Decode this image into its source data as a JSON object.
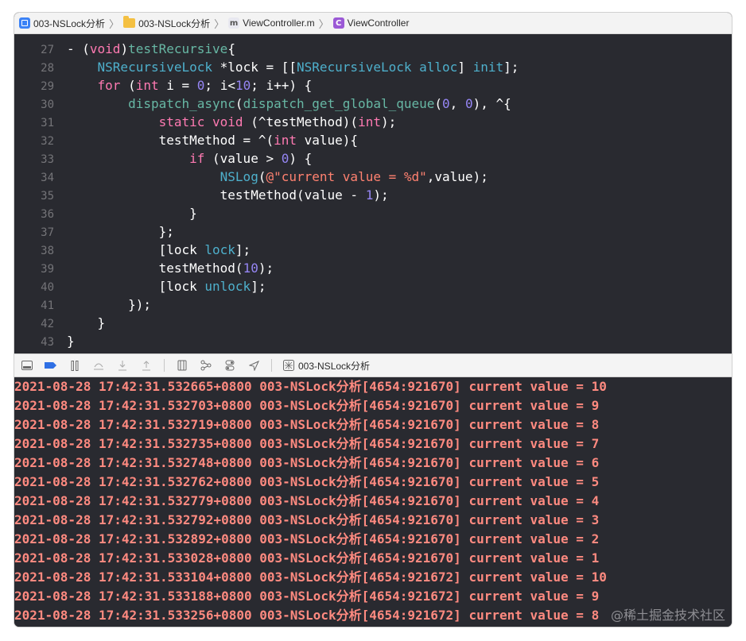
{
  "breadcrumb": {
    "items": [
      {
        "label": "003-NSLock分析",
        "icon": "project-icon"
      },
      {
        "label": "003-NSLock分析",
        "icon": "folder-icon"
      },
      {
        "label": "ViewController.m",
        "icon": "m-file-icon"
      },
      {
        "label": "ViewController",
        "icon": "class-icon"
      }
    ]
  },
  "editor": {
    "lines": [
      {
        "num": "27",
        "tokens": [
          [
            "pl",
            "- ("
          ],
          [
            "kw",
            "void"
          ],
          [
            "pl",
            ")"
          ],
          [
            "fn",
            "testRecursive"
          ],
          [
            "pl",
            "{"
          ]
        ]
      },
      {
        "num": "28",
        "tokens": [
          [
            "pl",
            "    "
          ],
          [
            "ty",
            "NSRecursiveLock"
          ],
          [
            "pl",
            " *lock = [["
          ],
          [
            "ty",
            "NSRecursiveLock"
          ],
          [
            "pl",
            " "
          ],
          [
            "ty",
            "alloc"
          ],
          [
            "pl",
            "] "
          ],
          [
            "ty",
            "init"
          ],
          [
            "pl",
            "];"
          ]
        ]
      },
      {
        "num": "29",
        "tokens": [
          [
            "pl",
            "    "
          ],
          [
            "kw",
            "for"
          ],
          [
            "pl",
            " ("
          ],
          [
            "kw",
            "int"
          ],
          [
            "pl",
            " i = "
          ],
          [
            "num",
            "0"
          ],
          [
            "pl",
            "; i<"
          ],
          [
            "num",
            "10"
          ],
          [
            "pl",
            "; i++) {"
          ]
        ]
      },
      {
        "num": "30",
        "tokens": [
          [
            "pl",
            "        "
          ],
          [
            "fn",
            "dispatch_async"
          ],
          [
            "pl",
            "("
          ],
          [
            "fn",
            "dispatch_get_global_queue"
          ],
          [
            "pl",
            "("
          ],
          [
            "num",
            "0"
          ],
          [
            "pl",
            ", "
          ],
          [
            "num",
            "0"
          ],
          [
            "pl",
            "), ^{"
          ]
        ]
      },
      {
        "num": "31",
        "tokens": [
          [
            "pl",
            "            "
          ],
          [
            "kw",
            "static"
          ],
          [
            "pl",
            " "
          ],
          [
            "kw",
            "void"
          ],
          [
            "pl",
            " (^testMethod)("
          ],
          [
            "kw",
            "int"
          ],
          [
            "pl",
            ");"
          ]
        ]
      },
      {
        "num": "32",
        "tokens": [
          [
            "pl",
            "            testMethod = ^("
          ],
          [
            "kw",
            "int"
          ],
          [
            "pl",
            " value){"
          ]
        ]
      },
      {
        "num": "33",
        "tokens": [
          [
            "pl",
            "                "
          ],
          [
            "kw",
            "if"
          ],
          [
            "pl",
            " (value > "
          ],
          [
            "num",
            "0"
          ],
          [
            "pl",
            ") {"
          ]
        ]
      },
      {
        "num": "34",
        "tokens": [
          [
            "pl",
            "                    "
          ],
          [
            "ty",
            "NSLog"
          ],
          [
            "pl",
            "("
          ],
          [
            "str",
            "@\"current value = %d\""
          ],
          [
            "pl",
            ",value);"
          ]
        ]
      },
      {
        "num": "35",
        "tokens": [
          [
            "pl",
            "                    testMethod(value - "
          ],
          [
            "num",
            "1"
          ],
          [
            "pl",
            ");"
          ]
        ]
      },
      {
        "num": "36",
        "tokens": [
          [
            "pl",
            "                }"
          ]
        ]
      },
      {
        "num": "37",
        "tokens": [
          [
            "pl",
            "            };"
          ]
        ]
      },
      {
        "num": "38",
        "tokens": [
          [
            "pl",
            "            [lock "
          ],
          [
            "ty",
            "lock"
          ],
          [
            "pl",
            "];"
          ]
        ]
      },
      {
        "num": "39",
        "tokens": [
          [
            "pl",
            "            testMethod("
          ],
          [
            "num",
            "10"
          ],
          [
            "pl",
            ");"
          ]
        ]
      },
      {
        "num": "40",
        "tokens": [
          [
            "pl",
            "            [lock "
          ],
          [
            "ty",
            "unlock"
          ],
          [
            "pl",
            "];"
          ]
        ]
      },
      {
        "num": "41",
        "tokens": [
          [
            "pl",
            "        });"
          ]
        ]
      },
      {
        "num": "42",
        "tokens": [
          [
            "pl",
            "    }"
          ]
        ]
      },
      {
        "num": "43",
        "tokens": [
          [
            "pl",
            "}"
          ]
        ]
      }
    ]
  },
  "debugbar": {
    "target_label": "003-NSLock分析"
  },
  "console": {
    "lines": [
      "2021-08-28 17:42:31.532665+0800 003-NSLock分析[4654:921670] current value = 10",
      "2021-08-28 17:42:31.532703+0800 003-NSLock分析[4654:921670] current value = 9",
      "2021-08-28 17:42:31.532719+0800 003-NSLock分析[4654:921670] current value = 8",
      "2021-08-28 17:42:31.532735+0800 003-NSLock分析[4654:921670] current value = 7",
      "2021-08-28 17:42:31.532748+0800 003-NSLock分析[4654:921670] current value = 6",
      "2021-08-28 17:42:31.532762+0800 003-NSLock分析[4654:921670] current value = 5",
      "2021-08-28 17:42:31.532779+0800 003-NSLock分析[4654:921670] current value = 4",
      "2021-08-28 17:42:31.532792+0800 003-NSLock分析[4654:921670] current value = 3",
      "2021-08-28 17:42:31.532892+0800 003-NSLock分析[4654:921670] current value = 2",
      "2021-08-28 17:42:31.533028+0800 003-NSLock分析[4654:921670] current value = 1",
      "2021-08-28 17:42:31.533104+0800 003-NSLock分析[4654:921672] current value = 10",
      "2021-08-28 17:42:31.533188+0800 003-NSLock分析[4654:921672] current value = 9",
      "2021-08-28 17:42:31.533256+0800 003-NSLock分析[4654:921672] current value = 8"
    ],
    "watermark": "@稀土掘金技术社区"
  }
}
